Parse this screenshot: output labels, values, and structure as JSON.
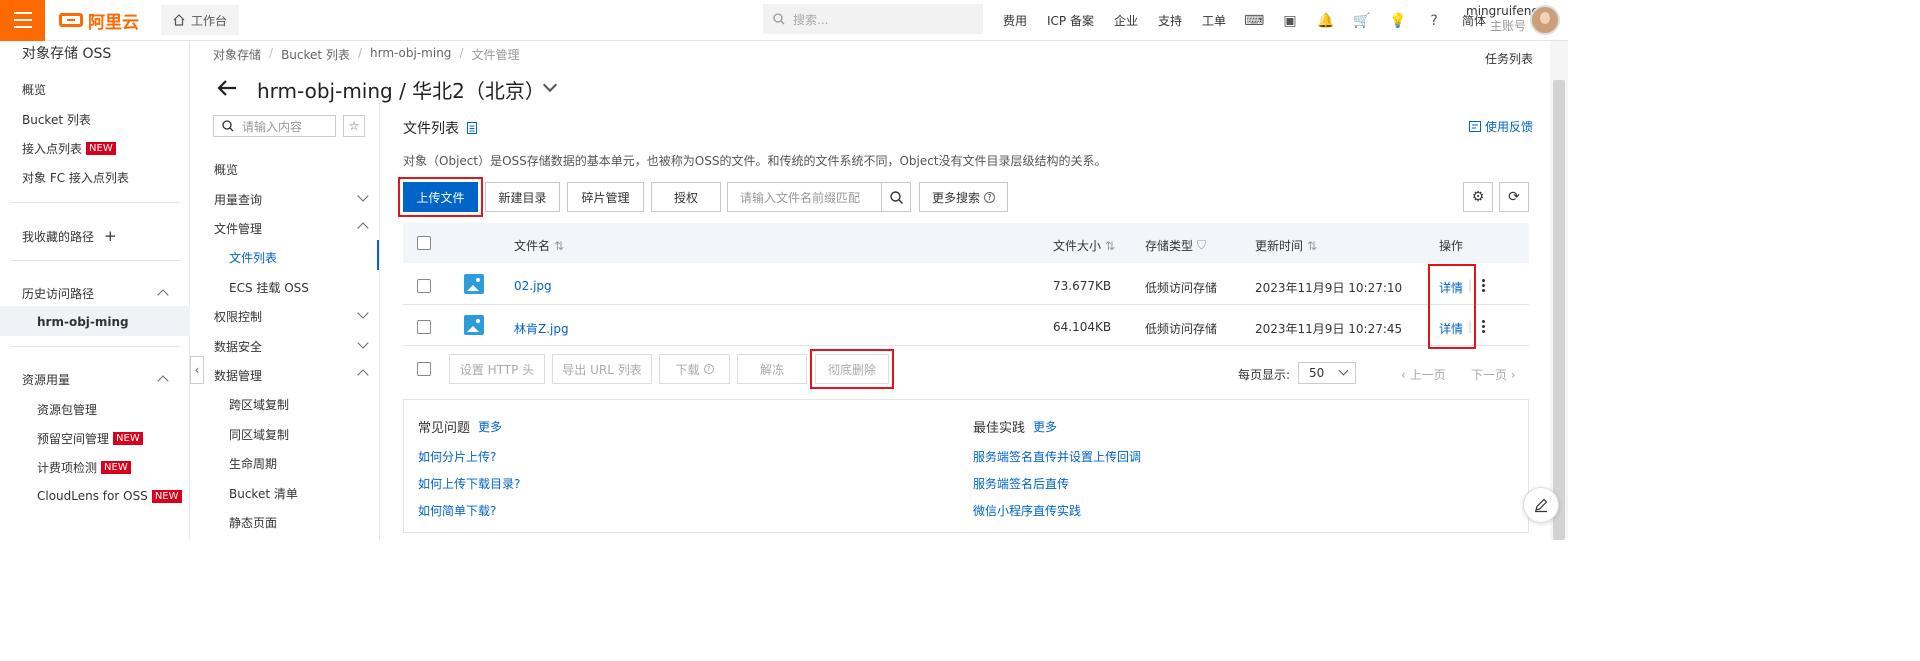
{
  "topbar": {
    "logo_text": "阿里云",
    "workbench_label": "工作台",
    "search_placeholder": "搜索...",
    "nav": [
      "费用",
      "ICP 备案",
      "企业",
      "支持",
      "工单"
    ],
    "lang": "简体",
    "user_name": "mingruifeng",
    "user_role": "主账号"
  },
  "sidebar": {
    "title": "对象存储 OSS",
    "items": [
      {
        "label": "概览"
      },
      {
        "label": "Bucket 列表"
      },
      {
        "label": "接入点列表",
        "badge": "NEW"
      },
      {
        "label": "对象 FC 接入点列表"
      }
    ],
    "favorites_label": "我收藏的路径",
    "history_label": "历史访问路径",
    "history_item": "hrm-obj-ming",
    "resources_label": "资源用量",
    "resource_items": [
      {
        "label": "资源包管理"
      },
      {
        "label": "预留空间管理",
        "badge": "NEW"
      },
      {
        "label": "计费项检测",
        "badge": "NEW"
      },
      {
        "label": "CloudLens for OSS",
        "badge": "NEW"
      }
    ]
  },
  "breadcrumb": [
    "对象存储",
    "Bucket 列表",
    "hrm-obj-ming",
    "文件管理"
  ],
  "task_list_label": "任务列表",
  "page_title": "hrm-obj-ming / 华北2（北京）",
  "subnav": {
    "search_placeholder": "请输入内容",
    "items": {
      "overview": "概览",
      "usage": "用量查询",
      "file_mgmt": "文件管理",
      "file_list": "文件列表",
      "ecs_mount": "ECS 挂载 OSS",
      "permission": "权限控制",
      "data_security": "数据安全",
      "data_mgmt": "数据管理",
      "cross_region": "跨区域复制",
      "same_region": "同区域复制",
      "lifecycle": "生命周期",
      "inventory": "Bucket 清单",
      "static_page": "静态页面"
    }
  },
  "main": {
    "title": "文件列表",
    "feedback": "使用反馈",
    "description": "对象（Object）是OSS存储数据的基本单元，也被称为OSS的文件。和传统的文件系统不同，Object没有文件目录层级结构的关系。",
    "toolbar": {
      "upload": "上传文件",
      "new_dir": "新建目录",
      "fragments": "碎片管理",
      "authorize": "授权",
      "search_placeholder": "请输入文件名前缀匹配",
      "more_search": "更多搜索"
    },
    "table": {
      "headers": {
        "name": "文件名",
        "size": "文件大小",
        "storage": "存储类型",
        "updated": "更新时间",
        "actions": "操作"
      },
      "rows": [
        {
          "name": "02.jpg",
          "size": "73.677KB",
          "storage": "低频访问存储",
          "updated": "2023年11月9日 10:27:10",
          "action": "详情"
        },
        {
          "name": "林肯Z.jpg",
          "size": "64.104KB",
          "storage": "低频访问存储",
          "updated": "2023年11月9日 10:27:45",
          "action": "详情"
        }
      ]
    },
    "bulk": {
      "set_http": "设置 HTTP 头",
      "export_url": "导出 URL 列表",
      "download": "下载",
      "unfreeze": "解冻",
      "delete": "彻底删除"
    },
    "pagination": {
      "per_page_label": "每页显示:",
      "per_page_value": "50",
      "prev": "上一页",
      "next": "下一页"
    },
    "faq": {
      "title": "常见问题",
      "more": "更多",
      "links": [
        "如何分片上传?",
        "如何上传下载目录?",
        "如何简单下载?"
      ]
    },
    "best": {
      "title": "最佳实践",
      "more": "更多",
      "links": [
        "服务端签名直传并设置上传回调",
        "服务端签名后直传",
        "微信小程序直传实践"
      ]
    }
  },
  "colors": {
    "brand": "#ff6a00",
    "primary": "#0064c8",
    "highlight": "#e0151e",
    "badge": "#d9001b"
  }
}
